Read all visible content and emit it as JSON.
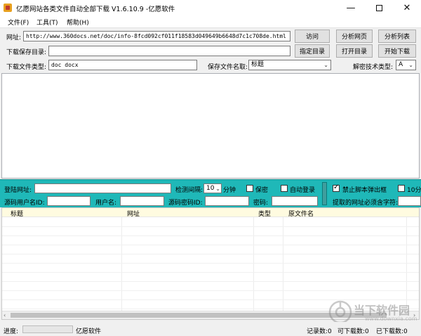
{
  "window": {
    "title": "亿愿网站各类文件自动全部下载 V1.6.10.9 -亿愿软件"
  },
  "menu": {
    "items": [
      "文件(F)",
      "工具(T)",
      "帮助(H)"
    ]
  },
  "form": {
    "url_label": "网址:",
    "url_value": "http://www.360docs.net/doc/info-8fcd092cf011f18583d049649b6648d7c1c708de.html",
    "save_dir_label": "下载保存目录:",
    "save_dir_value": "",
    "file_type_label": "下载文件类型:",
    "file_type_value": "doc docx",
    "save_name_label": "保存文件名取:",
    "save_name_value": "标题",
    "decrypt_label": "解密技术类型:",
    "decrypt_value": "A"
  },
  "buttons": {
    "visit": "访问",
    "analyze_page": "分析网页",
    "analyze_list": "分析列表",
    "set_dir": "指定目录",
    "open_dir": "打开目录",
    "start_download": "开始下载"
  },
  "login_panel": {
    "login_url_label": "登陆网址:",
    "interval_label": "检测间隔:",
    "interval_value": "10",
    "interval_unit": "分钟",
    "keep_secret_label": "保密",
    "auto_login_label": "自动登录",
    "block_popup_label": "禁止脚本弹出框",
    "ten_min_label": "10分钟",
    "src_user_label": "源码用户名ID:",
    "username_label": "用户名:",
    "src_pass_label": "源码密码ID:",
    "password_label": "密码:",
    "url_must_contain_label": "提取的网址必须含字符:"
  },
  "table": {
    "columns": [
      "标题",
      "网址",
      "类型",
      "原文件名"
    ]
  },
  "status": {
    "progress_label": "进度:",
    "brand": "亿愿软件",
    "records": "记录数:0",
    "downloadable": "可下载数:0",
    "downloaded": "已下载数:0"
  },
  "watermark": {
    "text": "当下软件园",
    "url": "www.downxia.com"
  }
}
